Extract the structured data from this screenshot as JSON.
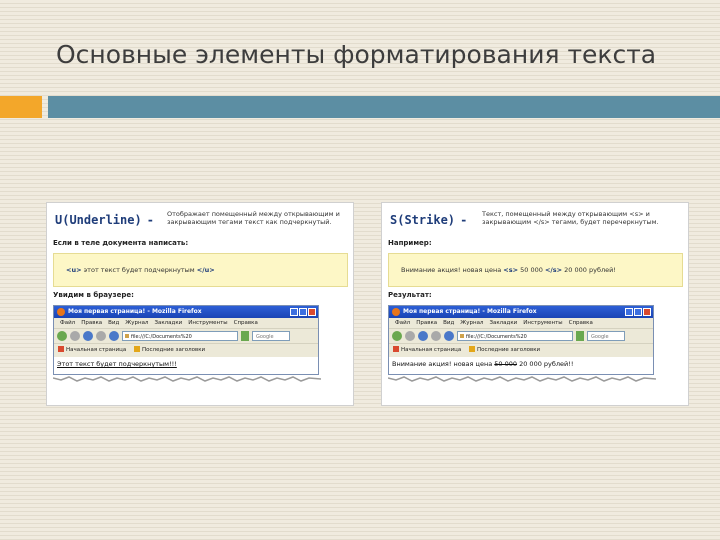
{
  "slide": {
    "title": "Основные элементы форматирования текста"
  },
  "colors": {
    "accent": "#f3a72a",
    "bar": "#5c8ea3",
    "panel_title": "#1f3d7a",
    "example_bg": "#fdf7c6"
  },
  "panels": [
    {
      "title": "U(Underline)",
      "dash": "-",
      "description": "Отображает помещенный между открывающим и закрывающим тегами текст как подчеркнутый.",
      "label_example": "Если в теле документа написать:",
      "code_open": "<u>",
      "example_text": "этот текст будет подчеркнутым",
      "code_close": "</u>",
      "label_result": "Увидим в браузере:",
      "browser": {
        "title": "Моя первая страница! - Mozilla Firefox",
        "menu": [
          "Файл",
          "Правка",
          "Вид",
          "Журнал",
          "Закладки",
          "Инструменты",
          "Справка"
        ],
        "url": "file:///C:/Documents%20",
        "search": "Google",
        "bookmarks": [
          "Начальная страница",
          "Последние заголовки"
        ],
        "page_text": "Этот текст будет подчеркнутым!!!"
      }
    },
    {
      "title": "S(Strike)",
      "dash": "-",
      "description": "Текст, помещенный между открывающим <s> и закрывающим </s> тегами, будет перечеркнутым.",
      "label_example": "Например:",
      "example_pre": "Внимание акция! новая цена",
      "code_open": "<s>",
      "example_struck": "50 000",
      "code_close": "</s>",
      "example_post": "20 000 рублей!",
      "label_result": "Результат:",
      "browser": {
        "title": "Моя первая страница! - Mozilla Firefox",
        "menu": [
          "Файл",
          "Правка",
          "Вид",
          "Журнал",
          "Закладки",
          "Инструменты",
          "Справка"
        ],
        "url": "file:///C:/Documents%20",
        "search": "Google",
        "bookmarks": [
          "Начальная страница",
          "Последние заголовки"
        ],
        "page_pre": "Внимание акция! новая цена",
        "page_struck": "50 000",
        "page_post": "20 000 рублей!!"
      }
    }
  ]
}
